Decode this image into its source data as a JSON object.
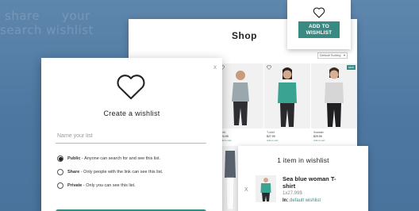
{
  "background": {
    "faded_words": [
      "share",
      "your",
      "search wishlist"
    ]
  },
  "shop": {
    "title": "Shop",
    "sort_label": "Default Sorting",
    "products": [
      {
        "name": "Shirt",
        "price": "$24.99",
        "link": "Add to cart",
        "badge": "",
        "color": "#9aa7ad",
        "top_color": "#8d9aa0"
      },
      {
        "name": "T-shirt",
        "price": "$27.99",
        "link": "Add to cart",
        "badge": "",
        "color": "#3aa392",
        "top_color": "#3aa392"
      },
      {
        "name": "Sweater",
        "price": "$29.99",
        "link": "Add to cart",
        "badge": "NEW",
        "color": "#c9c9c9",
        "top_color": "#d6d6d6"
      }
    ]
  },
  "add_to_wishlist": {
    "button_label": "ADD TO WISHLIST"
  },
  "modal": {
    "close": "x",
    "title": "Create a wishlist",
    "name_placeholder": "Name your list",
    "options": [
      {
        "key": "Public",
        "desc": " - Anyone can search for and see this list.",
        "checked": true
      },
      {
        "key": "Share",
        "desc": " - Only people with the link can see this list.",
        "checked": false
      },
      {
        "key": "Private",
        "desc": " - Only you can see this list.",
        "checked": false
      }
    ]
  },
  "wishlist_panel": {
    "title": "1 item in wishlist",
    "remove": "X",
    "item_name": "Sea blue woman T-shirt",
    "quantity_price": "1x27,99$",
    "in_label": "In:",
    "list_name": "default wishlist"
  },
  "colors": {
    "accent": "#3a8a84",
    "background": "#557ea8"
  },
  "icons": [
    "heart-icon",
    "close-icon"
  ]
}
